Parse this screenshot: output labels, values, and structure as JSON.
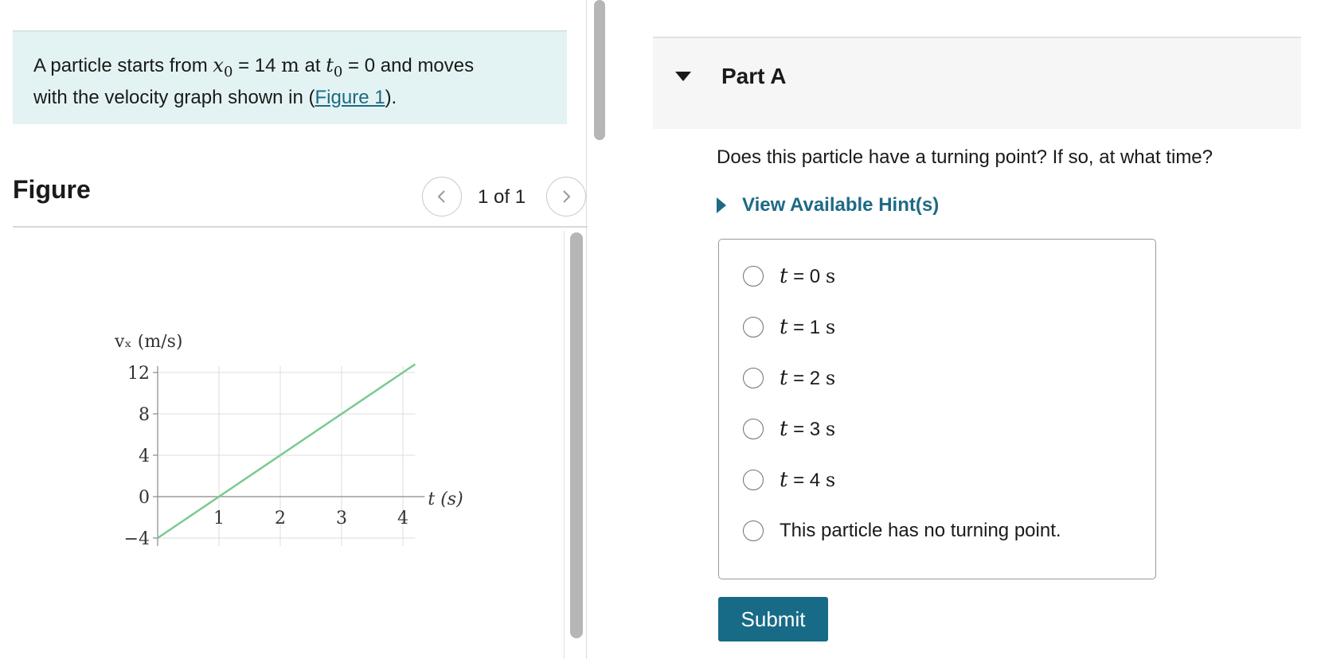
{
  "problem": {
    "text_before": "A particle starts from ",
    "x_var": "x",
    "x_sub": "0",
    "eq1": " = 14 ",
    "unit_m": "m",
    "mid": " at ",
    "t_var": "t",
    "t_sub": "0",
    "eq2": " = 0 and moves",
    "line2_before": "with the velocity graph shown in (",
    "figure_link": "Figure 1",
    "line2_after": ")."
  },
  "figure": {
    "title": "Figure",
    "page_count": "1 of 1"
  },
  "chart_data": {
    "type": "line",
    "ylabel": "v_x (m/s)",
    "xlabel": "t (s)",
    "x_ticks": [
      "1",
      "2",
      "3",
      "4"
    ],
    "y_ticks": [
      "12",
      "8",
      "4",
      "0",
      "−4"
    ],
    "xlim": [
      0,
      4.2
    ],
    "ylim": [
      -4,
      12
    ],
    "grid": true,
    "line_color": "#7cc98e",
    "series": [
      {
        "x": [
          0,
          4.2
        ],
        "y": [
          -4,
          12.8
        ]
      }
    ]
  },
  "part": {
    "title": "Part A",
    "question": "Does this particle have a turning point? If so, at what time?",
    "hint_label": "View Available Hint(s)",
    "options": [
      {
        "var": "t",
        "rest": " = 0 ",
        "unit": "s"
      },
      {
        "var": "t",
        "rest": " = 1 ",
        "unit": "s"
      },
      {
        "var": "t",
        "rest": " = 2 ",
        "unit": "s"
      },
      {
        "var": "t",
        "rest": " = 3 ",
        "unit": "s"
      },
      {
        "var": "t",
        "rest": " = 4 ",
        "unit": "s"
      },
      {
        "text": "This particle has no turning point."
      }
    ],
    "submit_label": "Submit"
  },
  "colors": {
    "accent": "#176b87",
    "link": "#1d6a84",
    "problem_bg": "#e3f3f3"
  }
}
